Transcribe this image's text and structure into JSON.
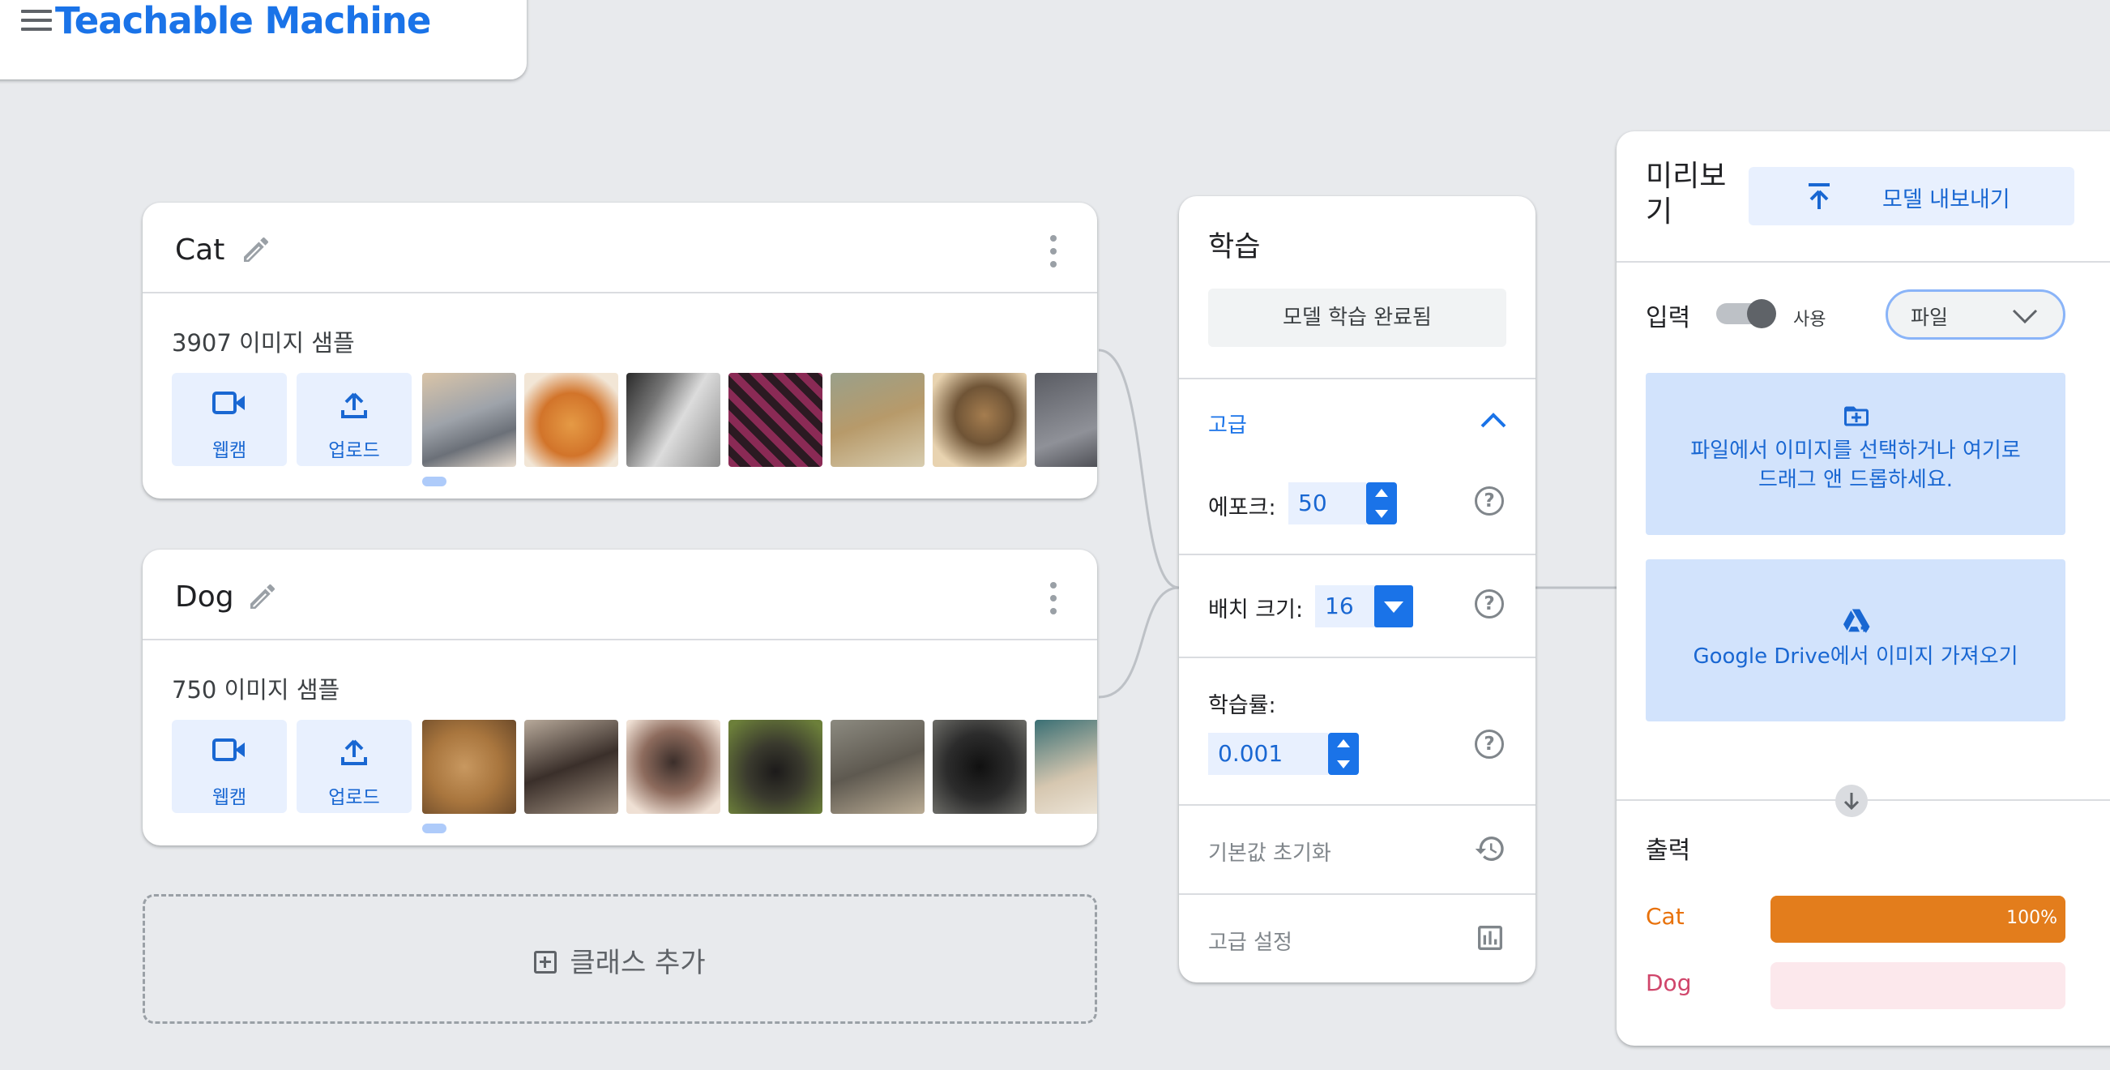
{
  "app": {
    "title": "Teachable Machine"
  },
  "colors": {
    "accent": "#1a73e8",
    "cat": "#e8710a",
    "dog": "#d0466b",
    "dog_track": "#fce8ec"
  },
  "classes": [
    {
      "name": "Cat",
      "sample_count": "3907 이미지 샘플",
      "webcam_label": "웹캠",
      "upload_label": "업로드"
    },
    {
      "name": "Dog",
      "sample_count": "750 이미지 샘플",
      "webcam_label": "웹캠",
      "upload_label": "업로드"
    }
  ],
  "add_class": {
    "label": "클래스 추가"
  },
  "training": {
    "title": "학습",
    "train_button": "모델 학습 완료됨",
    "advanced_label": "고급",
    "epochs_label": "에포크:",
    "epochs_value": "50",
    "batch_label": "배치 크기:",
    "batch_value": "16",
    "lr_label": "학습률:",
    "lr_value": "0.001",
    "help_glyph": "?",
    "reset_label": "기본값 초기화",
    "advanced_settings_label": "고급 설정"
  },
  "preview": {
    "title": "미리보기",
    "export_label": "모델 내보내기",
    "input_label": "입력",
    "toggle_label": "사용",
    "source_value": "파일",
    "file_zone_line1": "파일에서 이미지를 선택하거나 여기로",
    "file_zone_line2": "드래그 앤 드롭하세요.",
    "drive_label": "Google Drive에서 이미지 가져오기",
    "output_label": "출력",
    "results": [
      {
        "name": "Cat",
        "percent_text": "100%",
        "fraction": 1.0
      },
      {
        "name": "Dog",
        "percent_text": "",
        "fraction": 0.0
      }
    ]
  }
}
